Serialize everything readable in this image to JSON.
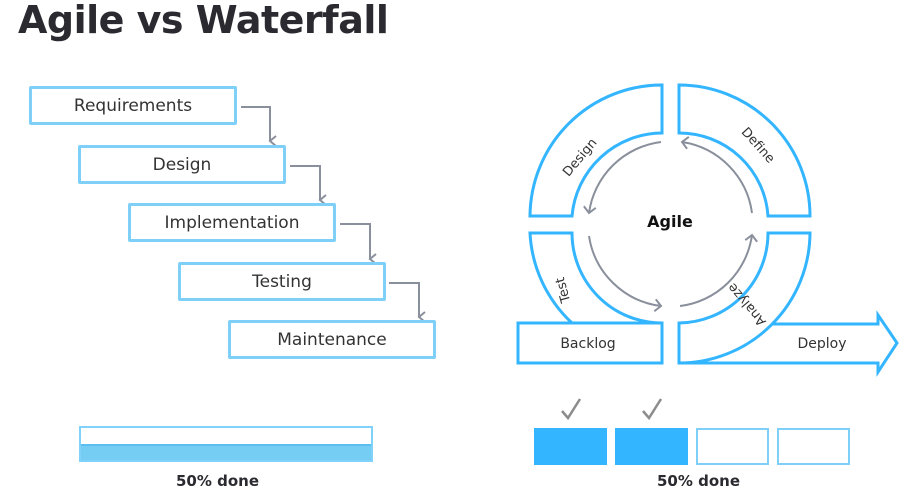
{
  "title": "Agile vs Waterfall",
  "colors": {
    "outline": "#33b5ff",
    "connector": "#8a8f9c",
    "fill_done": "#33b5ff",
    "bar_fill": "#76cdf4"
  },
  "waterfall": {
    "steps": [
      {
        "label": "Requirements"
      },
      {
        "label": "Design"
      },
      {
        "label": "Implementation"
      },
      {
        "label": "Testing"
      },
      {
        "label": "Maintenance"
      }
    ],
    "progress": {
      "percent": 50,
      "label": "50% done"
    }
  },
  "agile": {
    "center_label": "Agile",
    "segments": [
      {
        "label": "Define",
        "position": "top-right"
      },
      {
        "label": "Design",
        "position": "top-left"
      },
      {
        "label": "Test",
        "position": "bottom-left"
      },
      {
        "label": "Analyze",
        "position": "bottom-right"
      }
    ],
    "cycle_direction": "counterclockwise",
    "backlog_label": "Backlog",
    "deploy_label": "Deploy",
    "progress": {
      "label": "50% done",
      "blocks": [
        {
          "done": true,
          "icon": "check-icon"
        },
        {
          "done": true,
          "icon": "check-icon"
        },
        {
          "done": false
        },
        {
          "done": false
        }
      ]
    }
  }
}
